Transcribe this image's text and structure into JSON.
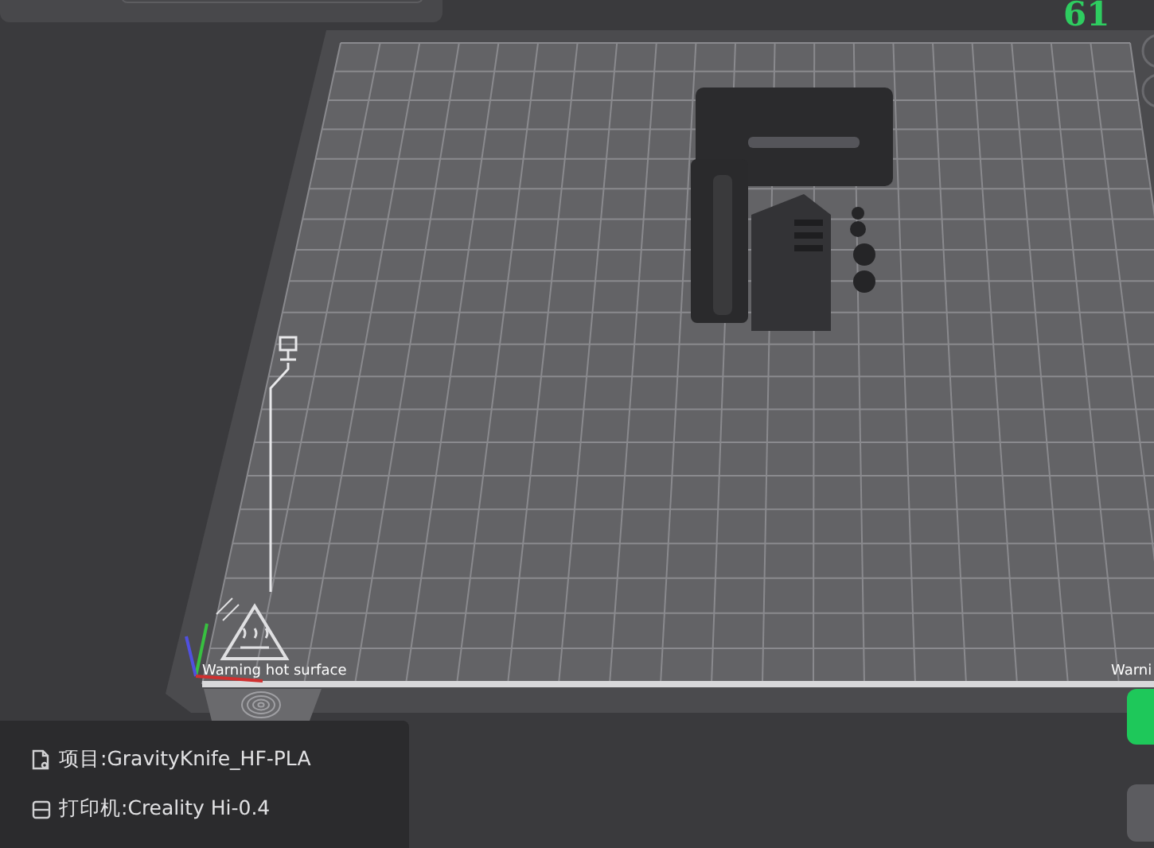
{
  "top_counter": "61",
  "plate_labels": [
    {
      "text": "Warning hot surface"
    },
    {
      "text": "Warni"
    }
  ],
  "project_info": [
    {
      "kind": "project",
      "text": "项目:GravityKnife_HF-PLA"
    },
    {
      "kind": "printer",
      "text": "打印机:Creality Hi-0.4"
    }
  ]
}
